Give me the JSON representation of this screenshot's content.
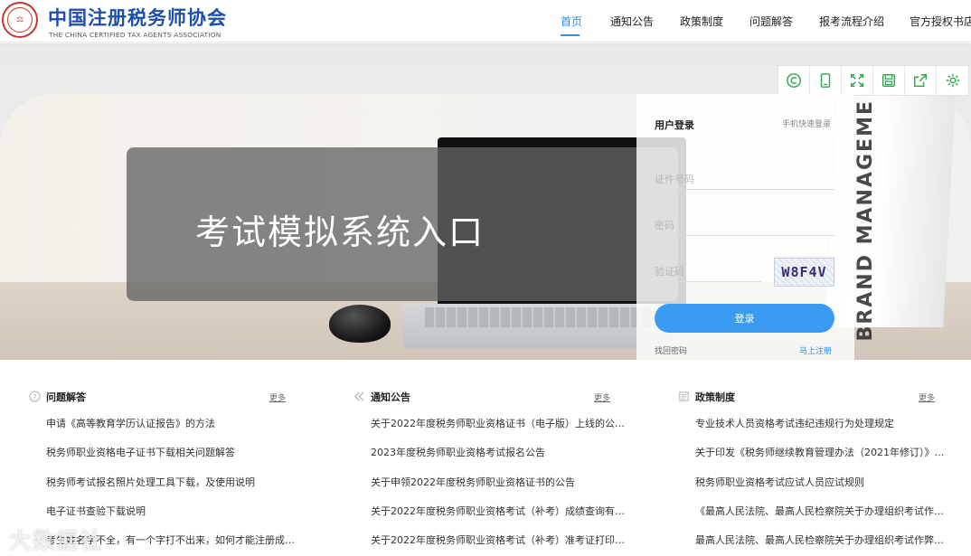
{
  "header": {
    "title": "中国注册税务师协会",
    "subtitle": "THE CHINA CERTIFIED TAX AGENTS ASSOCIATION",
    "nav": [
      {
        "label": "首页",
        "active": true
      },
      {
        "label": "通知公告",
        "active": false
      },
      {
        "label": "政策制度",
        "active": false
      },
      {
        "label": "问题解答",
        "active": false
      },
      {
        "label": "报考流程介绍",
        "active": false
      },
      {
        "label": "官方授权书店",
        "active": false
      }
    ],
    "accent_color": "#2d8cf0",
    "brand_color": "#1e4fa8"
  },
  "hero": {
    "banner_text": "考试模拟系统入口",
    "book_text": "BRAND MANAGEME"
  },
  "toolbar": {
    "icons": [
      "copyright-icon",
      "phone-icon",
      "fullscreen-icon",
      "save-icon",
      "share-icon",
      "settings-icon"
    ],
    "color": "#2aa84a"
  },
  "login": {
    "title": "用户登录",
    "alt_login": "手机快速登录",
    "id_placeholder": "证件号码",
    "password_placeholder": "密码",
    "captcha_placeholder": "验证码",
    "captcha_code": "W8F4V",
    "submit_label": "登录",
    "forgot_label": "找回密码",
    "register_label": "马上注册",
    "button_color": "#3b9bf3"
  },
  "sections": [
    {
      "title": "问题解答",
      "icon": "question-circle-icon",
      "more_label": "更多",
      "items": [
        "申请《高等教育学历认证报告》的方法",
        "税务师职业资格电子证书下载相关问题解答",
        "税务师考试报名照片处理工具下载，及使用说明",
        "电子证书查验下载说明",
        "考生姓名字不全，有一个字打不出来，如何才能注册成…"
      ]
    },
    {
      "title": "通知公告",
      "icon": "chevrons-left-icon",
      "more_label": "更多",
      "items": [
        "关于2022年度税务师职业资格证书（电子版）上线的公…",
        "2023年度税务师职业资格考试报名公告",
        "关于申领2022年度税务师职业资格证书的公告",
        "关于2022年度税务师职业资格考试（补考）成绩查询有…",
        "关于2022年度税务师职业资格考试（补考）准考证打印…"
      ]
    },
    {
      "title": "政策制度",
      "icon": "document-icon",
      "more_label": "更多",
      "items": [
        "专业技术人员资格考试违纪违规行为处理规定",
        "关于印发《税务师继续教育管理办法（2021年修订）》…",
        "税务师职业资格考试应试人员应试规则",
        "《最高人民法院、最高人民检察院关于办理组织考试作…",
        "最高人民法院、最高人民检察院关于办理组织考试作弊…"
      ]
    }
  ],
  "watermark": "大数据社"
}
